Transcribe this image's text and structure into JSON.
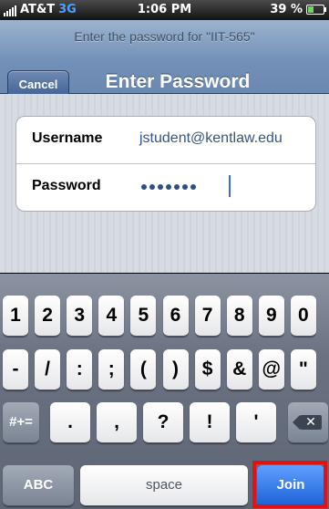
{
  "status_bar": {
    "carrier": "AT&T",
    "network": "3G",
    "time": "1:06 PM",
    "battery": "39 %",
    "battery_level": 0.39
  },
  "nav": {
    "prompt": "Enter the password for \"IIT-565\"",
    "cancel_label": "Cancel",
    "title": "Enter Password"
  },
  "form": {
    "username_label": "Username",
    "username_value": "jstudent@kentlaw.edu",
    "password_label": "Password",
    "password_length": 7
  },
  "keyboard": {
    "row1": [
      "1",
      "2",
      "3",
      "4",
      "5",
      "6",
      "7",
      "8",
      "9",
      "0"
    ],
    "row2": [
      "-",
      "/",
      ":",
      ";",
      "(",
      ")",
      "$",
      "&",
      "@",
      "\""
    ],
    "row3": [
      ".",
      ",",
      "?",
      "!",
      "'"
    ],
    "symbols_label": "#+=",
    "abc_label": "ABC",
    "space_label": "space",
    "join_label": "Join",
    "delete_icon": "backspace-icon"
  },
  "colors": {
    "accent": "#1d62d6",
    "highlight": "#e51010"
  }
}
